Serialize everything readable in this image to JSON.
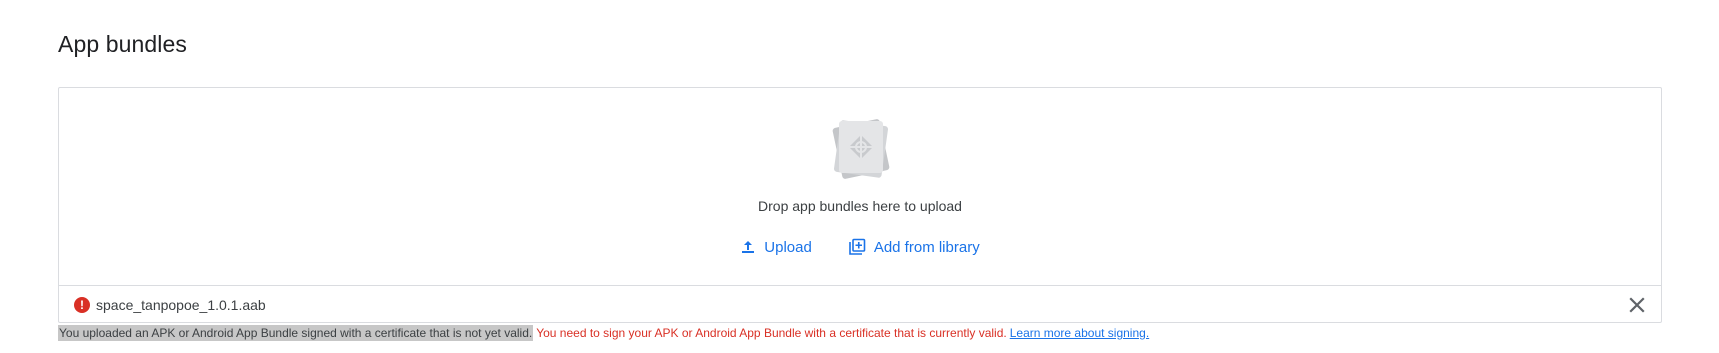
{
  "section": {
    "title": "App bundles"
  },
  "dropzone": {
    "illustration_icon": "app-bundle-stack-icon",
    "text": "Drop app bundles here to upload"
  },
  "actions": {
    "upload_label": "Upload",
    "upload_icon": "upload-icon",
    "library_label": "Add from library",
    "library_icon": "add-library-icon"
  },
  "file": {
    "name": "space_tanpopoe_1.0.1.aab",
    "status_icon": "error-icon",
    "remove_icon": "close-icon"
  },
  "error": {
    "message": "You uploaded an APK or Android App Bundle signed with a certificate that is not yet valid.",
    "instruction": "You need to sign your APK or Android App Bundle with a certificate that is currently valid.",
    "link": "Learn more about signing."
  },
  "colors": {
    "accent": "#1a73e8",
    "error": "#d93025",
    "border": "#dadce0",
    "highlight": "#c7c7c7"
  }
}
